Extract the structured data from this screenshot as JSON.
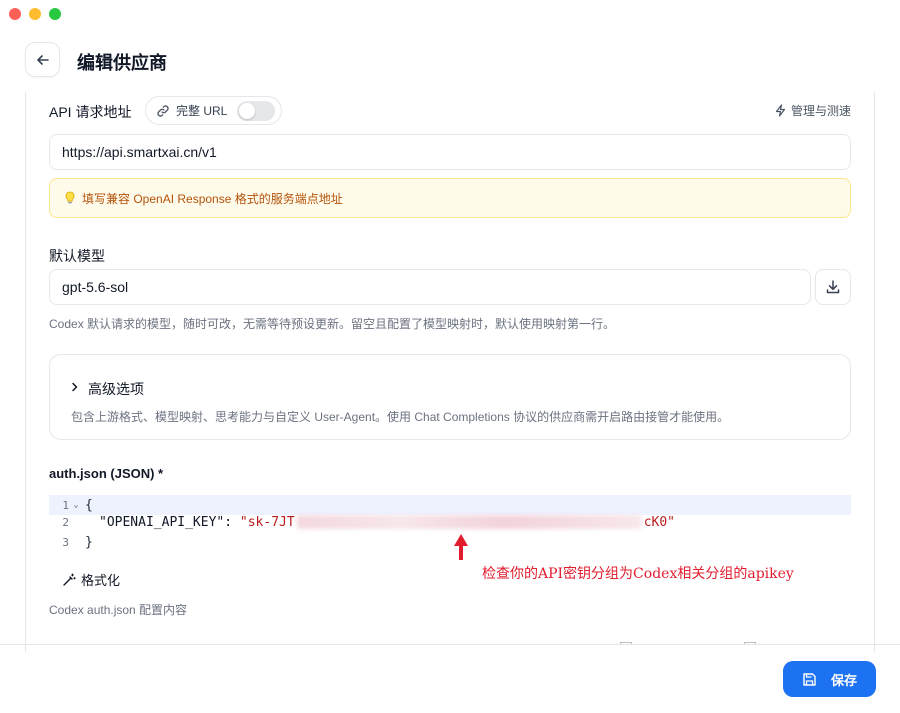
{
  "header": {
    "title": "编辑供应商"
  },
  "api": {
    "label": "API 请求地址",
    "full_url_label": "完整 URL",
    "full_url_enabled": false,
    "manage_label": "管理与测速",
    "url_value": "https://api.smartxai.cn/v1",
    "tip": "填写兼容 OpenAI Response 格式的服务端点地址"
  },
  "model": {
    "label": "默认模型",
    "value": "gpt-5.6-sol",
    "help": "Codex 默认请求的模型，随时可改，无需等待预设更新。留空且配置了模型映射时，默认使用映射第一行。"
  },
  "advanced": {
    "title": "高级选项",
    "description": "包含上游格式、模型映射、思考能力与自定义 User-Agent。使用 Chat Completions 协议的供应商需开启路由接管才能使用。"
  },
  "auth": {
    "label": "auth.json (JSON) *",
    "lines": [
      {
        "num": "1",
        "text": "{"
      },
      {
        "num": "2",
        "key": "\"OPENAI_API_KEY\"",
        "colon": ": ",
        "value_start": "\"sk-7JT",
        "value_end": "cK0\""
      },
      {
        "num": "3",
        "text": "}"
      }
    ],
    "format_label": "格式化",
    "help": "Codex auth.json 配置内容"
  },
  "annotation": "检查你的API密钥分组为Codex相关分组的apikey",
  "footer": {
    "save_label": "保存"
  },
  "colors": {
    "primary": "#1d72f3",
    "annotation": "#e11d2e",
    "tip_text": "#b45309"
  }
}
